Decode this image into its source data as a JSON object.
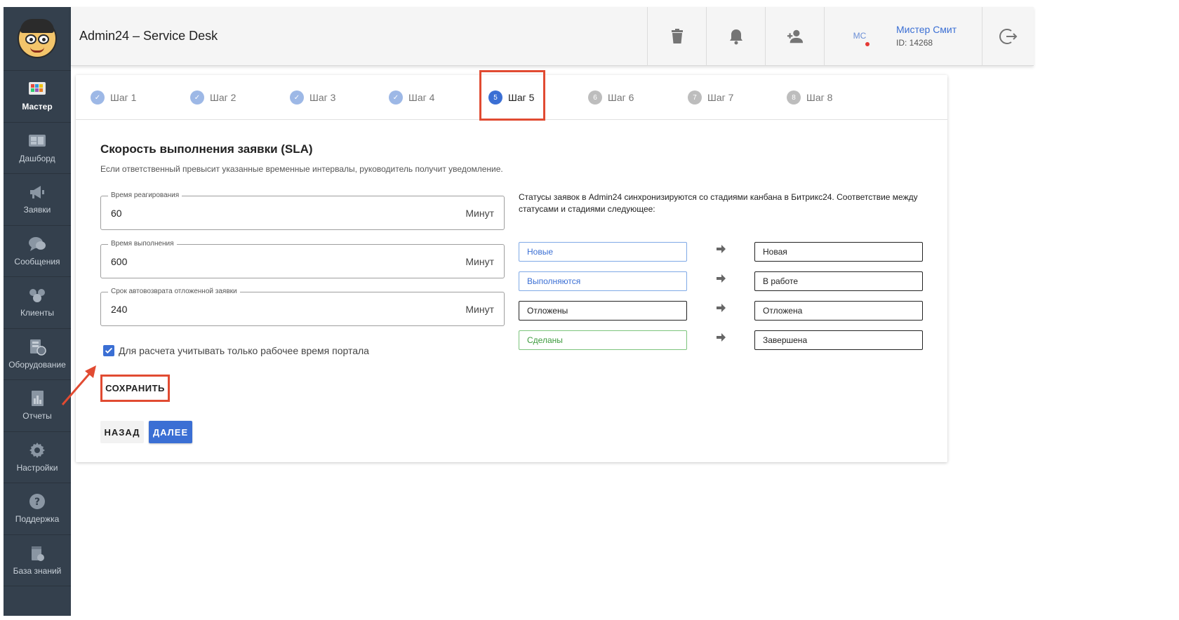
{
  "app": {
    "title": "Admin24 – Service Desk"
  },
  "sidebar": {
    "items": [
      {
        "label": "Мастер",
        "icon": "wizard-icon"
      },
      {
        "label": "Дашборд",
        "icon": "dashboard-icon"
      },
      {
        "label": "Заявки",
        "icon": "megaphone-icon"
      },
      {
        "label": "Сообщения",
        "icon": "chat-icon"
      },
      {
        "label": "Клиенты",
        "icon": "clients-icon"
      },
      {
        "label": "Оборудование",
        "icon": "equipment-icon"
      },
      {
        "label": "Отчеты",
        "icon": "reports-icon"
      },
      {
        "label": "Настройки",
        "icon": "gear-icon"
      },
      {
        "label": "Поддержка",
        "icon": "help-icon"
      },
      {
        "label": "База знаний",
        "icon": "knowledge-base-icon"
      }
    ]
  },
  "topbar": {
    "user": {
      "initials": "МС",
      "name": "Мистер Смит",
      "id": "ID: 14268"
    }
  },
  "stepper": {
    "steps": [
      {
        "label": "Шаг 1",
        "num": "✓"
      },
      {
        "label": "Шаг 2",
        "num": "✓"
      },
      {
        "label": "Шаг 3",
        "num": "✓"
      },
      {
        "label": "Шаг 4",
        "num": "✓"
      },
      {
        "label": "Шаг 5",
        "num": "5"
      },
      {
        "label": "Шаг 6",
        "num": "6"
      },
      {
        "label": "Шаг 7",
        "num": "7"
      },
      {
        "label": "Шаг 8",
        "num": "8"
      }
    ]
  },
  "sla": {
    "title": "Скорость выполнения заявки (SLA)",
    "description": "Если ответственный превысит указанные временные интервалы, руководитель получит уведомление.",
    "fields": [
      {
        "label": "Время реагирования",
        "value": "60",
        "unit": "Минут"
      },
      {
        "label": "Время выполнения",
        "value": "600",
        "unit": "Минут"
      },
      {
        "label": "Срок автовозврата отложенной заявки",
        "value": "240",
        "unit": "Минут"
      }
    ],
    "checkbox_label": "Для расчета учитывать только рабочее время портала",
    "save_label": "СОХРАНИТЬ",
    "back_label": "НАЗАД",
    "next_label": "ДАЛЕЕ"
  },
  "mapping": {
    "text": "Статусы заявок в Admin24 синхронизируются со стадиями канбана в Битрикс24. Соответствие между статусами и стадиями следующее:",
    "rows": [
      {
        "left": "Новые",
        "right": "Новая"
      },
      {
        "left": "Выполняются",
        "right": "В работе"
      },
      {
        "left": "Отложены",
        "right": "Отложена"
      },
      {
        "left": "Сделаны",
        "right": "Завершена"
      }
    ]
  },
  "colors": {
    "accent": "#3b6fd4",
    "sidebar": "#34404d",
    "highlight": "#e14b32"
  }
}
